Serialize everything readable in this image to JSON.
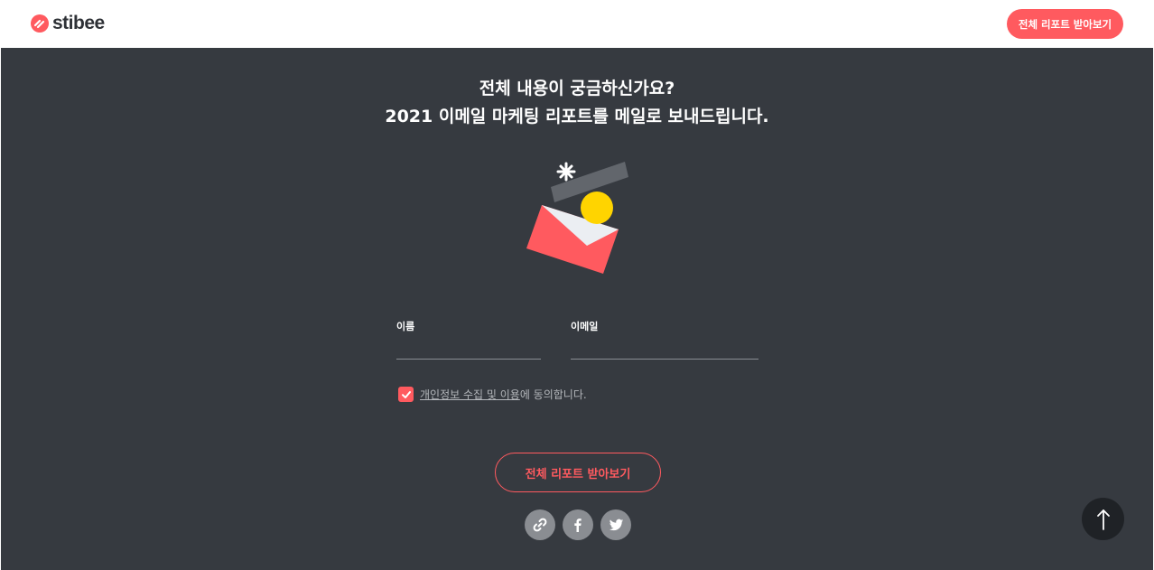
{
  "header": {
    "logo_text": "stibee",
    "cta_label": "전체 리포트 받아보기"
  },
  "main": {
    "headline_line1": "전체 내용이 궁금하신가요?",
    "headline_line2": "2021 이메일 마케팅 리포트를 메일로 보내드립니다.",
    "form": {
      "name_label": "이름",
      "name_value": "",
      "email_label": "이메일",
      "email_value": ""
    },
    "consent": {
      "checked": true,
      "link_text": "개인정보 수집 및 이용",
      "rest_text": "에 동의합니다."
    },
    "submit_label": "전체 리포트 받아보기",
    "share_icons": [
      "link-icon",
      "facebook-icon",
      "twitter-icon"
    ]
  },
  "scroll_top_icon": "arrow-up-icon",
  "colors": {
    "accent": "#ff5a5f",
    "background_dark": "#363a40",
    "header_bg": "#ffffff",
    "yellow": "#ffd400"
  }
}
